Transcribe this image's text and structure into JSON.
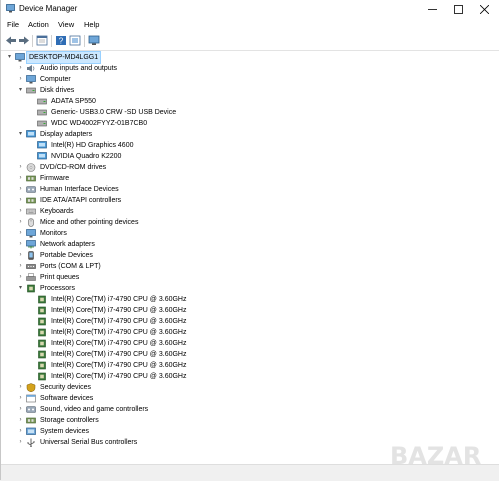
{
  "window": {
    "title": "Device Manager"
  },
  "menu": {
    "file": "File",
    "action": "Action",
    "view": "View",
    "help": "Help"
  },
  "tree": {
    "root": "DESKTOP-MD4LGG1",
    "categories": [
      {
        "label": "Audio inputs and outputs",
        "icon": "speaker-icon",
        "expanded": false
      },
      {
        "label": "Computer",
        "icon": "computer-icon",
        "expanded": false
      },
      {
        "label": "Disk drives",
        "icon": "disk-drive-icon",
        "expanded": true,
        "children": [
          "ADATA SP550",
          "Generic- USB3.0 CRW   -SD USB Device",
          "WDC WD4002FYYZ-01B7CB0"
        ]
      },
      {
        "label": "Display adapters",
        "icon": "display-adapter-icon",
        "expanded": true,
        "children": [
          "Intel(R) HD Graphics 4600",
          "NVIDIA Quadro K2200"
        ]
      },
      {
        "label": "DVD/CD-ROM drives",
        "icon": "dvd-drive-icon",
        "expanded": false
      },
      {
        "label": "Firmware",
        "icon": "firmware-icon",
        "expanded": false
      },
      {
        "label": "Human Interface Devices",
        "icon": "hid-icon",
        "expanded": false
      },
      {
        "label": "IDE ATA/ATAPI controllers",
        "icon": "ide-controller-icon",
        "expanded": false
      },
      {
        "label": "Keyboards",
        "icon": "keyboard-icon",
        "expanded": false
      },
      {
        "label": "Mice and other pointing devices",
        "icon": "mouse-icon",
        "expanded": false
      },
      {
        "label": "Monitors",
        "icon": "monitor-icon",
        "expanded": false
      },
      {
        "label": "Network adapters",
        "icon": "network-adapter-icon",
        "expanded": false
      },
      {
        "label": "Portable Devices",
        "icon": "portable-device-icon",
        "expanded": false
      },
      {
        "label": "Ports (COM & LPT)",
        "icon": "port-icon",
        "expanded": false
      },
      {
        "label": "Print queues",
        "icon": "printer-icon",
        "expanded": false
      },
      {
        "label": "Processors",
        "icon": "processor-icon",
        "expanded": true,
        "children": [
          "Intel(R) Core(TM) i7-4790 CPU @ 3.60GHz",
          "Intel(R) Core(TM) i7-4790 CPU @ 3.60GHz",
          "Intel(R) Core(TM) i7-4790 CPU @ 3.60GHz",
          "Intel(R) Core(TM) i7-4790 CPU @ 3.60GHz",
          "Intel(R) Core(TM) i7-4790 CPU @ 3.60GHz",
          "Intel(R) Core(TM) i7-4790 CPU @ 3.60GHz",
          "Intel(R) Core(TM) i7-4790 CPU @ 3.60GHz",
          "Intel(R) Core(TM) i7-4790 CPU @ 3.60GHz"
        ]
      },
      {
        "label": "Security devices",
        "icon": "security-device-icon",
        "expanded": false
      },
      {
        "label": "Software devices",
        "icon": "software-device-icon",
        "expanded": false
      },
      {
        "label": "Sound, video and game controllers",
        "icon": "sound-controller-icon",
        "expanded": false
      },
      {
        "label": "Storage controllers",
        "icon": "storage-controller-icon",
        "expanded": false
      },
      {
        "label": "System devices",
        "icon": "system-device-icon",
        "expanded": false
      },
      {
        "label": "Universal Serial Bus controllers",
        "icon": "usb-controller-icon",
        "expanded": false
      }
    ]
  },
  "watermark": {
    "text": "BAZAR"
  },
  "colors": {
    "selection": "#cce8ff",
    "accent": "#0078d7",
    "chip": "#3c7a3c"
  }
}
